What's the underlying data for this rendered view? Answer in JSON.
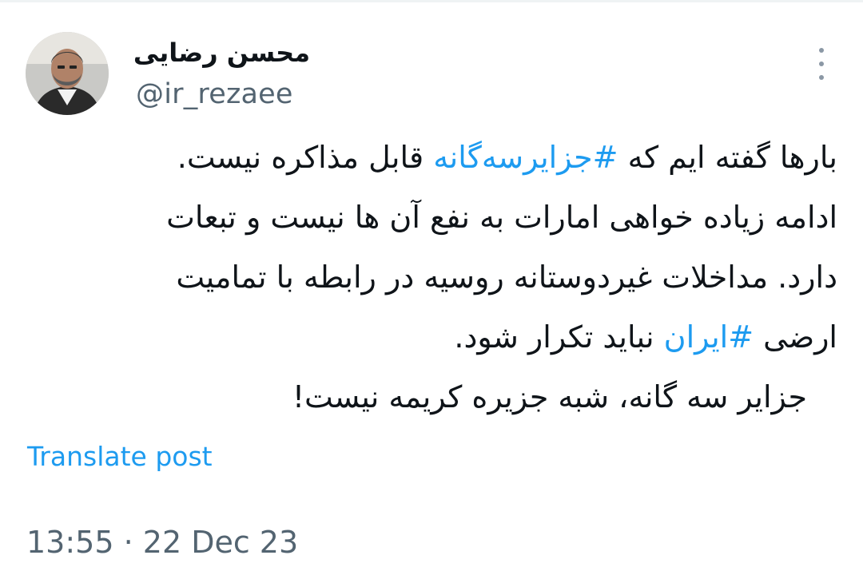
{
  "author": {
    "display_name": "محسن رضایی",
    "handle": "@ir_rezaee"
  },
  "tweet": {
    "line1_a": "بارها گفته ایم که ",
    "hashtag1": "#جزایرسه‌گانه",
    "line1_b": " قابل مذاکره نیست.",
    "line2": "ادامه زیاده خواهی امارات به نفع آن ها نیست و تبعات",
    "line3": "دارد. مداخلات غیردوستانه روسیه در رابطه با تمامیت",
    "line4_a": "ارضی ",
    "hashtag2": "#ایران",
    "line4_b": " نباید تکرار شود.",
    "line5": "جزایر سه گانه، شبه جزیره کریمه نیست!"
  },
  "translate_label": "Translate post",
  "meta": {
    "time": "13:55",
    "separator": " · ",
    "date": "22 Dec 23"
  },
  "icons": {
    "more": "more-vertical-icon",
    "avatar": "profile-photo"
  },
  "colors": {
    "link": "#1d9bf0",
    "secondary_text": "#536471"
  }
}
